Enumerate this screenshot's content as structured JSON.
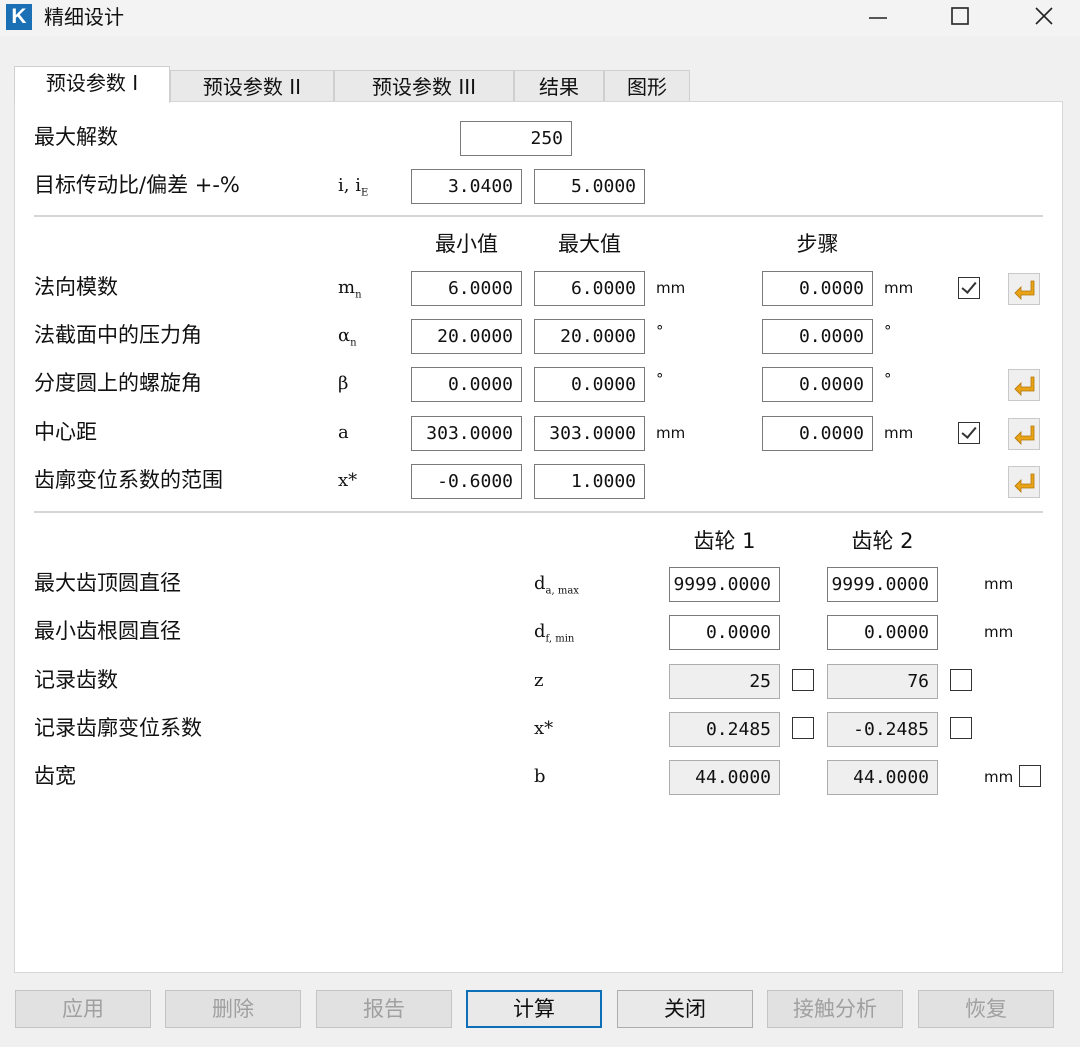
{
  "window": {
    "logo_letter": "K",
    "title": "精细设计",
    "minimize_label": "minimize",
    "maximize_label": "maximize",
    "close_label": "close"
  },
  "tabs": [
    {
      "label": "预设参数 I",
      "active": true
    },
    {
      "label": "预设参数 II",
      "active": false
    },
    {
      "label": "预设参数 III",
      "active": false
    },
    {
      "label": "结果",
      "active": false
    },
    {
      "label": "图形",
      "active": false
    }
  ],
  "section1": {
    "max_solutions": {
      "label": "最大解数",
      "value": "250"
    },
    "target_ratio": {
      "label": "目标传动比/偏差 +-%",
      "symbol": "i, i",
      "symbol_sub": "E",
      "value": "3.0400",
      "deviation": "5.0000"
    }
  },
  "section2": {
    "headers": {
      "min": "最小值",
      "max": "最大值",
      "step": "步骤"
    },
    "rows": [
      {
        "label": "法向模数",
        "symbol": "m",
        "symbol_sub": "n",
        "min": "6.0000",
        "max": "6.0000",
        "unit": "mm",
        "step": "0.0000",
        "step_unit": "mm",
        "checked": true,
        "arrow": true
      },
      {
        "label": "法截面中的压力角",
        "symbol": "α",
        "symbol_sub": "n",
        "min": "20.0000",
        "max": "20.0000",
        "unit": "°",
        "step": "0.0000",
        "step_unit": "°",
        "checked": null,
        "arrow": false
      },
      {
        "label": "分度圆上的螺旋角",
        "symbol": "β",
        "symbol_sub": "",
        "min": "0.0000",
        "max": "0.0000",
        "unit": "°",
        "step": "0.0000",
        "step_unit": "°",
        "checked": null,
        "arrow": true
      },
      {
        "label": "中心距",
        "symbol": "a",
        "symbol_sub": "",
        "min": "303.0000",
        "max": "303.0000",
        "unit": "mm",
        "step": "0.0000",
        "step_unit": "mm",
        "checked": true,
        "arrow": true
      },
      {
        "label": "齿廓变位系数的范围",
        "symbol": "x*",
        "symbol_sub": "",
        "min": "-0.6000",
        "max": "1.0000",
        "unit": "",
        "step": null,
        "step_unit": "",
        "checked": null,
        "arrow": true
      }
    ]
  },
  "section3": {
    "headers": {
      "gear1": "齿轮 1",
      "gear2": "齿轮 2"
    },
    "rows": [
      {
        "label": "最大齿顶圆直径",
        "symbol": "d",
        "symbol_sub": "a, max",
        "gear1": "9999.0000",
        "gear2": "9999.0000",
        "readonly": false,
        "unit": "mm",
        "check1": null,
        "check2": null,
        "check_unit": null
      },
      {
        "label": "最小齿根圆直径",
        "symbol": "d",
        "symbol_sub": "f, min",
        "gear1": "0.0000",
        "gear2": "0.0000",
        "readonly": false,
        "unit": "mm",
        "check1": null,
        "check2": null,
        "check_unit": null
      },
      {
        "label": "记录齿数",
        "symbol": "z",
        "symbol_sub": "",
        "gear1": "25",
        "gear2": "76",
        "readonly": true,
        "unit": "",
        "check1": false,
        "check2": false,
        "check_unit": null
      },
      {
        "label": "记录齿廓变位系数",
        "symbol": "x*",
        "symbol_sub": "",
        "gear1": "0.2485",
        "gear2": "-0.2485",
        "readonly": true,
        "unit": "",
        "check1": false,
        "check2": false,
        "check_unit": null
      },
      {
        "label": "齿宽",
        "symbol": "b",
        "symbol_sub": "",
        "gear1": "44.0000",
        "gear2": "44.0000",
        "readonly": true,
        "unit": "mm",
        "check1": null,
        "check2": null,
        "check_unit": false
      }
    ]
  },
  "buttons": [
    {
      "label": "应用",
      "enabled": false,
      "default": false
    },
    {
      "label": "删除",
      "enabled": false,
      "default": false
    },
    {
      "label": "报告",
      "enabled": false,
      "default": false
    },
    {
      "label": "计算",
      "enabled": true,
      "default": true
    },
    {
      "label": "关闭",
      "enabled": true,
      "default": false
    },
    {
      "label": "接触分析",
      "enabled": false,
      "default": false
    },
    {
      "label": "恢复",
      "enabled": false,
      "default": false
    }
  ],
  "colors": {
    "accent": "#0d6fb8",
    "logo_bg": "#1a6fb5",
    "arrow_icon": "#e8a317"
  }
}
